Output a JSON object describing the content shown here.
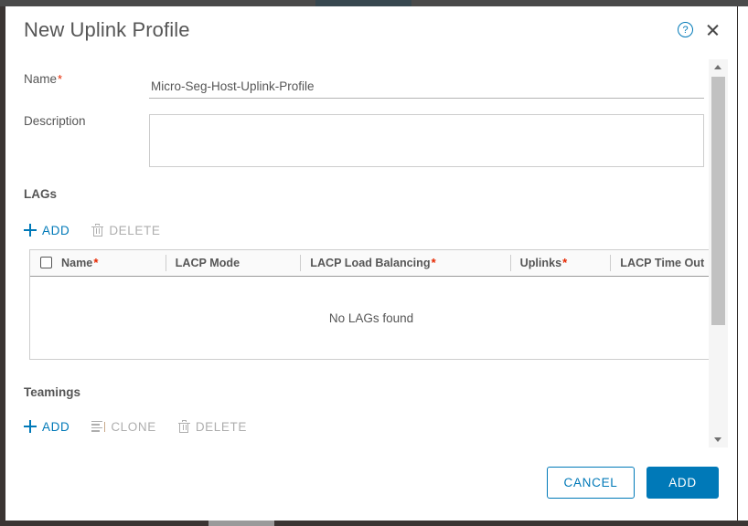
{
  "dialog": {
    "title": "New Uplink Profile",
    "help_icon": "help-circle-icon",
    "close_icon": "close-icon"
  },
  "form": {
    "name": {
      "label": "Name",
      "required_marker": "*",
      "value": "Micro-Seg-Host-Uplink-Profile",
      "placeholder": ""
    },
    "description": {
      "label": "Description",
      "value": "",
      "placeholder": ""
    }
  },
  "lags": {
    "section_title": "LAGs",
    "toolbar": [
      {
        "label": "ADD",
        "icon": "plus-icon",
        "enabled": true
      },
      {
        "label": "DELETE",
        "icon": "trash-icon",
        "enabled": false
      }
    ],
    "columns": [
      {
        "label": "Name",
        "required_marker": "*"
      },
      {
        "label": "LACP Mode",
        "required_marker": ""
      },
      {
        "label": "LACP Load Balancing",
        "required_marker": "*"
      },
      {
        "label": "Uplinks",
        "required_marker": "*"
      },
      {
        "label": "LACP Time Out",
        "required_marker": ""
      }
    ],
    "rows": [],
    "empty_message": "No LAGs found"
  },
  "teamings": {
    "section_title": "Teamings",
    "toolbar": [
      {
        "label": "ADD",
        "icon": "plus-icon",
        "enabled": true
      },
      {
        "label": "CLONE",
        "icon": "clone-icon",
        "enabled": false
      },
      {
        "label": "DELETE",
        "icon": "trash-icon",
        "enabled": false
      }
    ]
  },
  "footer": {
    "cancel_label": "CANCEL",
    "submit_label": "ADD"
  },
  "colors": {
    "accent_blue": "#0079b8",
    "required_red": "#e62700",
    "text": "#565656",
    "disabled": "#aeaeae"
  }
}
